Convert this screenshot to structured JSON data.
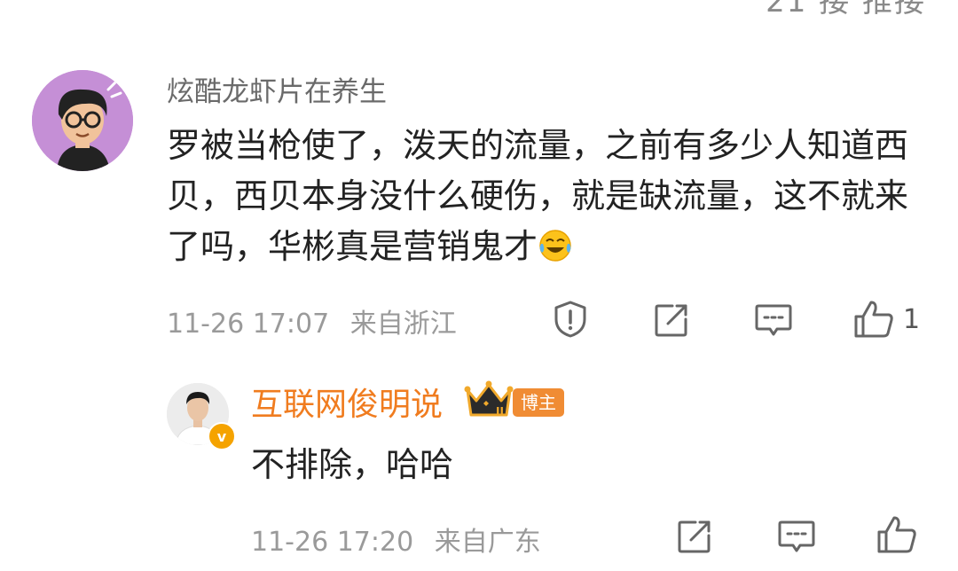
{
  "header": {
    "fragment_text": "21 接 推接"
  },
  "main_comment": {
    "username": "炫酷龙虾片在养生",
    "text": "罗被当枪使了，泼天的流量，之前有多少人知道西贝，西贝本身没什么硬伤，就是缺流量，这不就来了吗，华彬真是营销鬼才",
    "emoji": "laugh-cry-emoji",
    "timestamp": "11-26 17:07",
    "location": "来自浙江",
    "like_count": "1",
    "icons": [
      "report-icon",
      "share-icon",
      "comment-icon",
      "like-icon"
    ]
  },
  "reply": {
    "username": "互联网俊明说",
    "badge": "博主",
    "crown_level": "II",
    "verified_mark": "v",
    "text": "不排除，哈哈",
    "timestamp": "11-26 17:20",
    "location": "来自广东",
    "icons": [
      "share-icon",
      "comment-icon",
      "like-icon"
    ]
  },
  "colors": {
    "username_gray": "#6a6a6a",
    "blogger_orange": "#f07c1f",
    "badge_orange": "#f08c34",
    "meta_gray": "#9a9a9a",
    "avatar_purple": "#c58fd6"
  }
}
